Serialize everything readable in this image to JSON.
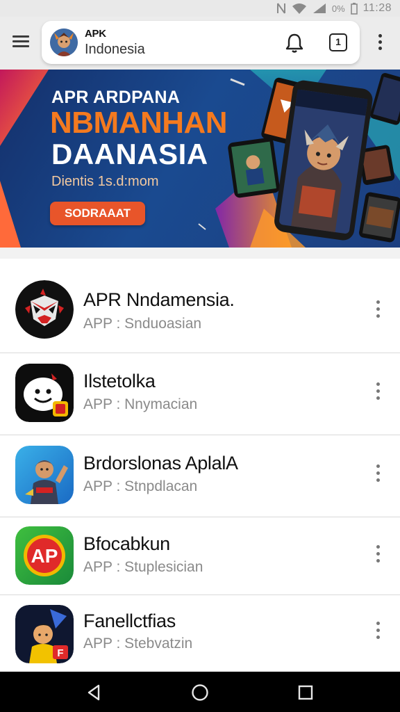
{
  "status_bar": {
    "battery": "0%",
    "time": "11:28",
    "icons": [
      "nfc-icon",
      "wifi-icon",
      "signal-icon",
      "battery-icon"
    ]
  },
  "header": {
    "menu_icon": "hamburger-icon",
    "brand_title": "APK",
    "brand_subtitle": "Indonesia",
    "notification_icon": "bell-icon",
    "tab_count": "1",
    "overflow_icon": "more-vert-icon"
  },
  "banner": {
    "line1": "APR ARDPANA",
    "line2": "NBMANHAN",
    "line3": "DAANASIA",
    "line4": "Dientis 1s.d:mom",
    "cta": "SODRAAAT",
    "colors": {
      "accent": "#f47a1f",
      "cta": "#e8552a",
      "background": "#1a4a90"
    }
  },
  "apps": [
    {
      "name": "APR Nndamensia.",
      "subtitle": "APP : Snduoasian",
      "icon": "ninja-mask-icon"
    },
    {
      "name": "Ilstetolka",
      "subtitle": "APP : Nnymacian",
      "icon": "smiley-face-icon"
    },
    {
      "name": "Brdorslonas AplalA",
      "subtitle": "APP : Stnpdlacan",
      "icon": "warrior-character-icon"
    },
    {
      "name": "Bfocabkun",
      "subtitle": "APP : Stuplesician",
      "icon": "ap-logo-icon"
    },
    {
      "name": "Fanellctfias",
      "subtitle": "APP : Stebvatzin",
      "icon": "cartoon-boy-icon"
    }
  ],
  "nav_bar": {
    "back_icon": "back-triangle-icon",
    "home_icon": "home-circle-icon",
    "recents_icon": "recents-square-icon"
  }
}
